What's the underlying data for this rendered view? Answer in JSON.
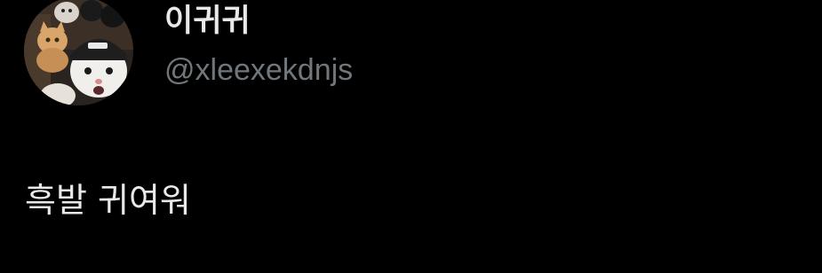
{
  "tweet": {
    "author": {
      "display_name": "이귀귀",
      "handle": "@xleexekdnjs",
      "avatar_icon": "cat-photo-avatar"
    },
    "text": "흑발 귀여워"
  },
  "colors": {
    "background": "#000000",
    "primary_text": "#e7e9ea",
    "secondary_text": "#71767b"
  }
}
